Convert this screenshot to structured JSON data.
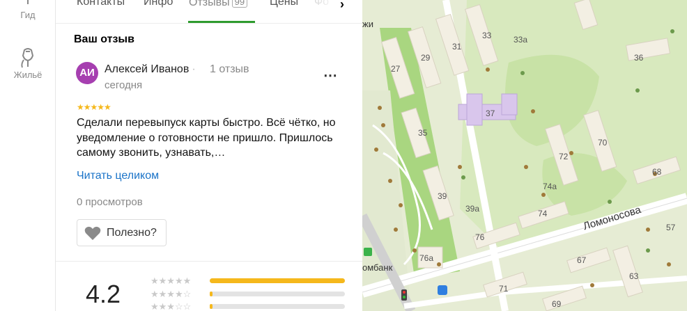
{
  "rail": {
    "items": [
      {
        "label": "Гид",
        "icon": "guide-icon"
      },
      {
        "label": "Жильё",
        "icon": "housing-icon"
      }
    ]
  },
  "tabs": {
    "items": [
      "Контакты",
      "Инфо",
      "Отзывы",
      "Цены",
      "Фо"
    ],
    "active": "Отзывы",
    "reviews_badge": "99"
  },
  "review": {
    "section_title": "Ваш отзыв",
    "avatar_initials": "АИ",
    "avatar_color": "#a63fb0",
    "author": "Алексей Иванов",
    "count": "1 отзыв",
    "date": "сегодня",
    "stars": 5,
    "text": "Сделали перевыпуск карты быстро. Всё чётко, но уведомление о готовности не пришло. Пришлось самому звонить, узнавать,…",
    "read_more": "Читать целиком",
    "views": "0 просмотров",
    "useful": "Полезно?"
  },
  "rating": {
    "value": "4.2",
    "bars": [
      {
        "stars": 5,
        "fill": 1.0
      },
      {
        "stars": 4,
        "fill": 0.02
      },
      {
        "stars": 3,
        "fill": 0.02
      }
    ],
    "accent": "#f5b81c"
  },
  "map": {
    "house_numbers": [
      "27",
      "29",
      "31",
      "33",
      "33а",
      "35",
      "36",
      "37",
      "39",
      "39а",
      "57",
      "63",
      "67",
      "68",
      "69",
      "70",
      "71",
      "72",
      "74",
      "74а",
      "76",
      "76а"
    ],
    "streets": [
      "Ломоносова",
      "жи",
      "омбанк"
    ]
  },
  "colors": {
    "active_tab": "#2e9b2e",
    "link": "#1a73c8"
  }
}
